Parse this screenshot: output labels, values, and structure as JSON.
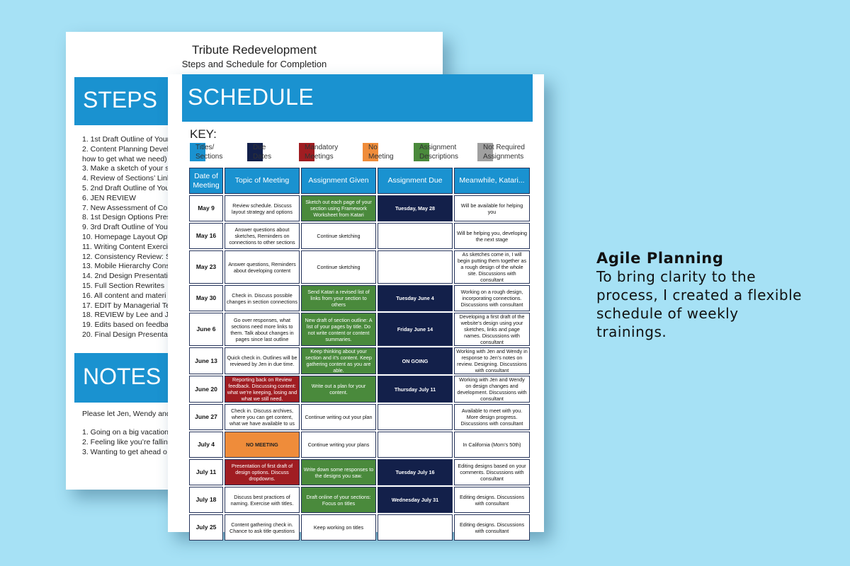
{
  "back_page": {
    "title": "Tribute Redevelopment",
    "subtitle": "Steps and Schedule for Completion",
    "steps_heading": "STEPS",
    "steps": [
      "1. 1st Draft Outline of Your",
      "2. Content Planning Devel",
      "how to get what we need)",
      "3. Make a sketch of your s",
      "4. Review of Sections’ Link",
      "5. 2nd Draft Outline of You",
      "6. JEN REVIEW",
      "7. New Assessment of Con",
      "8. 1st Design Options Pres",
      "9. 3rd Draft Outline of You",
      "10. Homepage Layout Opt",
      "11. Writing Content Exerci",
      "12. Consistency Review: S",
      "13. Mobile Hierarchy Cons",
      "14. 2nd Design Presentati",
      "15. Full Section Rewrites",
      "16. All content and materi",
      "17. EDIT by Managerial Te",
      "18. REVIEW by Lee and Jen",
      "19. Edits based on feedba",
      "20. Final Design Presentat"
    ],
    "notes_heading": "NOTES",
    "notes_intro": "Please let Jen, Wendy and",
    "notes": [
      "1. Going on a big vacation",
      "2. Feeling like you’re fallin",
      "3. Wanting to get ahead o"
    ]
  },
  "front_page": {
    "heading": "SCHEDULE",
    "key_label": "KEY:",
    "key": [
      {
        "label": "Titles/\nSections",
        "color": "#1a92d0"
      },
      {
        "label": "Due\nDates",
        "color": "#13204a"
      },
      {
        "label": "Mandatory\nMeetings",
        "color": "#a01d22"
      },
      {
        "label": "No\nMeeting",
        "color": "#ef8c3a"
      },
      {
        "label": "Assignment\nDescriptions",
        "color": "#4a8a3c"
      },
      {
        "label": "Not Required\nAssignments",
        "color": "#a0a0a0"
      }
    ],
    "columns": [
      "Date of Meeting",
      "Topic of Meeting",
      "Assignment Given",
      "Assignment Due",
      "Meanwhile, Katari..."
    ],
    "rows": [
      {
        "date": "May 9",
        "topic": "Review schedule. Discuss layout strategy and options",
        "topic_style": "",
        "given": "Sketch out each page of your section using Framework Worksheet from Katari",
        "given_style": "green",
        "due": "Tuesday, May 28",
        "meanwhile": "Will be available for helping you"
      },
      {
        "date": "May 16",
        "topic": "Answer questions about sketches, Reminders on connections to other sections",
        "topic_style": "",
        "given": "Continue sketching",
        "given_style": "",
        "due": "",
        "meanwhile": "Will be helping you, developing the next stage"
      },
      {
        "date": "May 23",
        "topic": "Answer questions, Reminders about developing content",
        "topic_style": "",
        "given": "Continue sketching",
        "given_style": "",
        "due": "",
        "meanwhile": "As sketches come in, I will begin putting them together as a rough design of the whole site. Discussions with consultant"
      },
      {
        "date": "May 30",
        "topic": "Check in. Discuss possible changes in section connections",
        "topic_style": "",
        "given": "Send Katari a revised list of links from your section to others",
        "given_style": "green",
        "due": "Tuesday June 4",
        "meanwhile": "Working on a rough design, incorporating connections. Discussions with consultant"
      },
      {
        "date": "June 6",
        "topic": "Go over responses, what sections need more links to them. Talk about changes in pages since last outline",
        "topic_style": "",
        "given": "New draft of section outline: A list of your pages by title. Do not write content or content summaries.",
        "given_style": "green",
        "due": "Friday June 14",
        "meanwhile": "Developing a first draft of the website’s design using your sketches, links and page names. Discussions with consultant"
      },
      {
        "date": "June 13",
        "topic": "Quick check in. Outlines will be reviewed by Jen in due time.",
        "topic_style": "",
        "given": "Keep thinking about your section and it’s content. Keep gathering content as you are able.",
        "given_style": "green",
        "due": "ON GOING",
        "meanwhile": "Working with Jen and Wendy in response to Jen’s notes on review. Designing.  Discussions with consultant"
      },
      {
        "date": "June 20",
        "topic": "Reporting back on Review feedback. Discussing content: what we’re keeping, losing and what we still need.",
        "topic_style": "red",
        "given": "Write out a plan for your content.",
        "given_style": "green",
        "due": "Thursday July 11",
        "meanwhile": "Working with Jen and Wendy on design changes and development.  Discussions with consultant"
      },
      {
        "date": "June 27",
        "topic": "Check in. Discuss archives, where you can get content, what we have available to us",
        "topic_style": "",
        "given": "Continue writing out your plan",
        "given_style": "",
        "due": "",
        "meanwhile": "Available to meet with you. More design progress. Discussions with consultant"
      },
      {
        "date": "July 4",
        "topic": "NO MEETING",
        "topic_style": "orange",
        "given": "Continue writing your plans",
        "given_style": "",
        "due": "",
        "meanwhile": "In California (Mom’s 50th)"
      },
      {
        "date": "July 11",
        "topic": "Presentation of first draft of design options. Discuss dropdowns.",
        "topic_style": "red",
        "given": "Write down some responses to the designs you saw.",
        "given_style": "green",
        "due": "Tuesday July 16",
        "meanwhile": "Editing designs based on your comments.  Discussions with consultant"
      },
      {
        "date": "July 18",
        "topic": "Discuss best practices of naming. Exercise with titles.",
        "topic_style": "",
        "given": "Draft online of your sections: Focus on titles",
        "given_style": "green",
        "due": "Wednesday July 31",
        "meanwhile": "Editing designs.  Discussions with consultant"
      },
      {
        "date": "July 25",
        "topic": "Content gathering check in. Chance to ask title questions",
        "topic_style": "",
        "given": "Keep working on titles",
        "given_style": "",
        "due": "",
        "meanwhile": "Editing designs.  Discussions with consultant"
      }
    ]
  },
  "caption": {
    "title": "Agile Planning",
    "body": "To bring clarity to the process, I created a flexible schedule of weekly trainings."
  },
  "colors": {
    "background": "#a6e1f5",
    "accent_blue": "#1a92d0",
    "due_navy": "#13204a",
    "mandatory_red": "#a01d22",
    "no_meeting_orange": "#ef8c3a",
    "assignment_green": "#4a8a3c",
    "not_required_gray": "#a0a0a0"
  }
}
